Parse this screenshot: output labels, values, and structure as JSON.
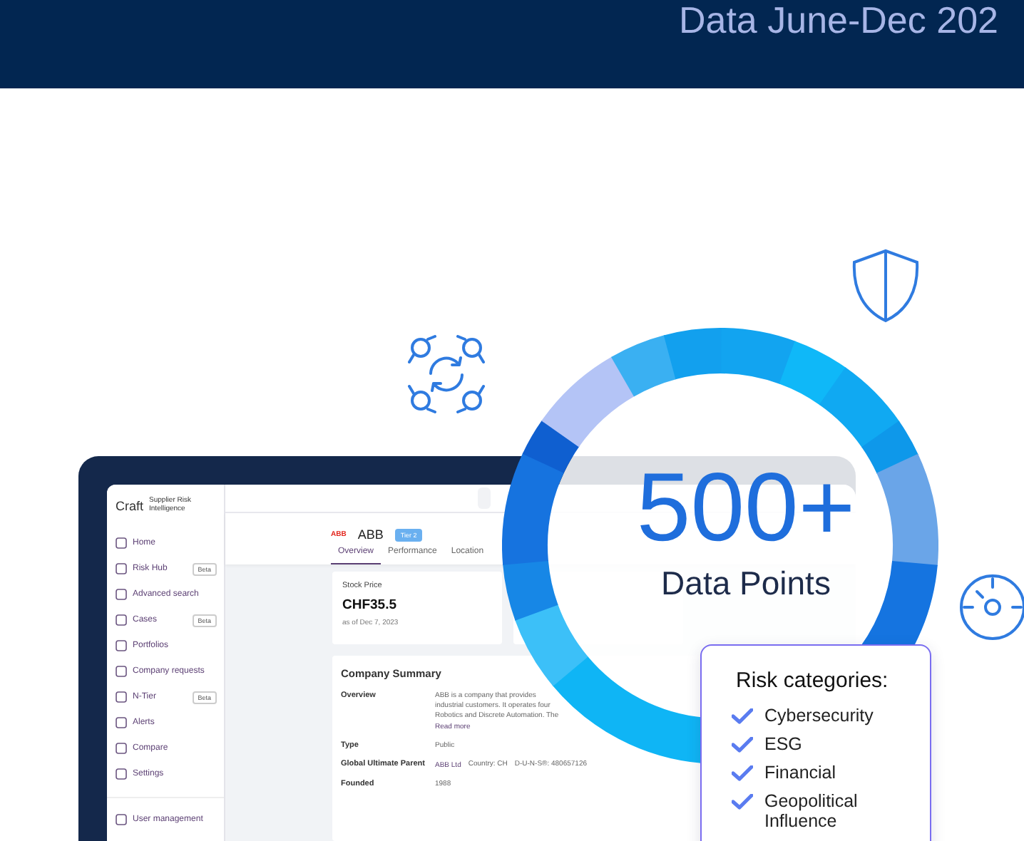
{
  "banner": {
    "title": "Data June-Dec 202"
  },
  "app": {
    "brand": "Craft",
    "product": "Supplier Risk Intelligence",
    "nav": [
      {
        "label": "Home"
      },
      {
        "label": "Risk Hub",
        "badge": "Beta"
      },
      {
        "label": "Advanced search"
      },
      {
        "label": "Cases",
        "badge": "Beta"
      },
      {
        "label": "Portfolios"
      },
      {
        "label": "Company requests"
      },
      {
        "label": "N-Tier",
        "badge": "Beta"
      },
      {
        "label": "Alerts"
      },
      {
        "label": "Compare"
      },
      {
        "label": "Settings"
      }
    ],
    "footer_nav": [
      {
        "label": "User management"
      }
    ],
    "company": {
      "logo": "ABB",
      "name": "ABB",
      "tier": "Tier 2"
    },
    "tabs": [
      {
        "label": "Overview",
        "selected": true
      },
      {
        "label": "Performance",
        "selected": false
      },
      {
        "label": "Location",
        "selected": false
      }
    ],
    "stock": {
      "label": "Stock Price",
      "value": "CHF35.5",
      "date": "as of Dec 7, 2023"
    },
    "summary": {
      "title": "Company Summary",
      "rows": [
        {
          "kind": "overview",
          "label": "Overview",
          "lines": [
            "ABB is a company that provides",
            "industrial customers. It operates four",
            "Robotics and Discrete Automation. The"
          ],
          "link": "Read more"
        },
        {
          "kind": "plain",
          "label": "Type",
          "value": "Public"
        },
        {
          "kind": "parent",
          "label": "Global Ultimate Parent",
          "parent": "ABB Ltd",
          "country": "Country: CH",
          "duns": "D-U-N-S®: 480657126"
        },
        {
          "kind": "plain",
          "label": "Founded",
          "value": "1988"
        }
      ]
    }
  },
  "stat": {
    "value": "500+",
    "label": "Data Points"
  },
  "risk": {
    "title": "Risk categories:",
    "items": [
      "Cybersecurity",
      "ESG",
      "Financial",
      "Geopolitical Influence"
    ]
  }
}
